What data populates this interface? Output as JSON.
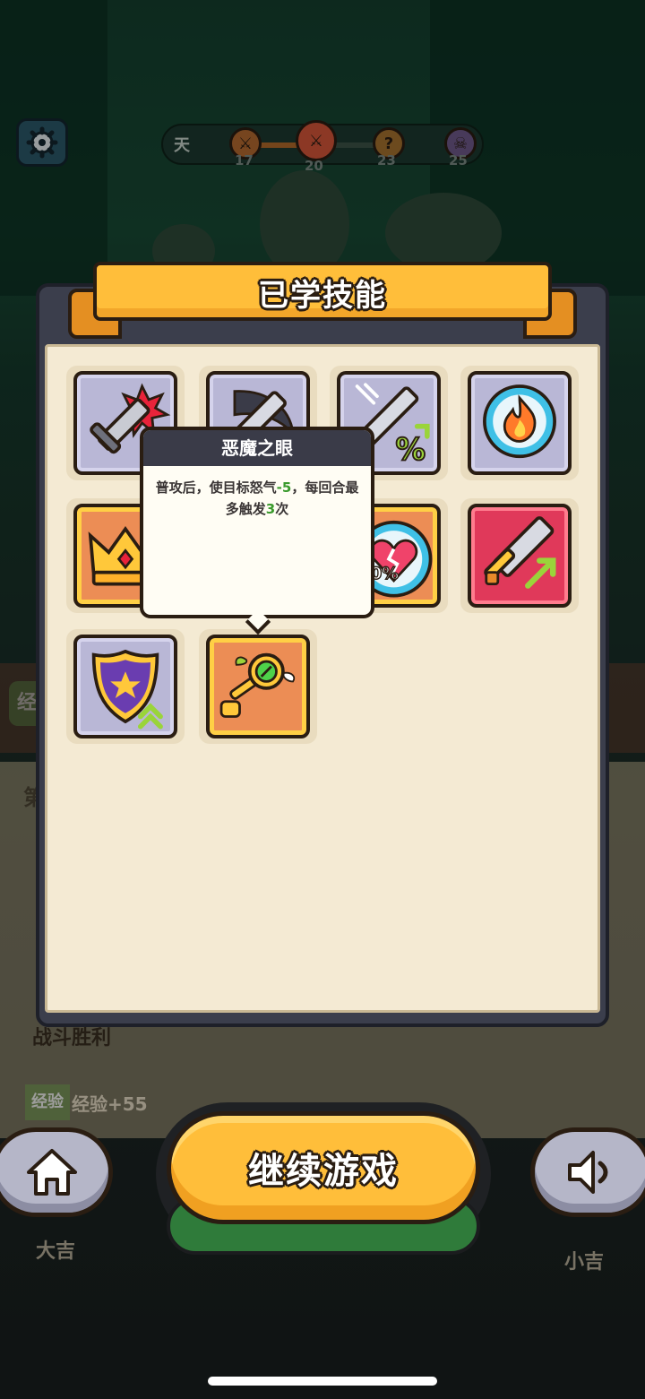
{
  "hud": {
    "day_label": "天",
    "progress_nodes": [
      "17",
      "20",
      "23",
      "25"
    ],
    "question_mark": "?"
  },
  "background": {
    "exp_short": "经",
    "section_label": "第",
    "victory_text": "战斗胜利",
    "exp_badge": "经验",
    "exp_gain": "经验+55",
    "great_luck": "大吉",
    "small_luck": "小吉"
  },
  "modal": {
    "title": "已学技能",
    "skills": [
      {
        "icon": "sword-burst-icon",
        "frame": "grey"
      },
      {
        "icon": "shadow-blade-icon",
        "frame": "grey"
      },
      {
        "icon": "sword-percent-up-icon",
        "frame": "grey"
      },
      {
        "icon": "fire-orb-icon",
        "frame": "grey"
      },
      {
        "icon": "crown-icon",
        "frame": "orange"
      },
      {
        "icon": "broken-heart-icon",
        "frame": "orange",
        "label": "30%"
      },
      {
        "icon": "sword-attack-up-icon",
        "frame": "red"
      },
      {
        "icon": "shield-upgrade-icon",
        "frame": "grey"
      },
      {
        "icon": "demon-eye-key-icon",
        "frame": "orange"
      }
    ]
  },
  "tooltip": {
    "title": "恶魔之眼",
    "desc_part1": "普攻后，使目标怒气",
    "desc_value1": "-5",
    "desc_part2": "，每回合最多触发",
    "desc_value2": "3",
    "desc_part3": "次"
  },
  "buttons": {
    "continue_label": "继续游戏",
    "home_icon": "home-icon",
    "sound_icon": "speaker-icon"
  },
  "colors": {
    "accent": "#ffbe3a",
    "outline": "#2a1d12",
    "paper": "#f4ead3",
    "highlight_green": "#3a9a2c"
  }
}
